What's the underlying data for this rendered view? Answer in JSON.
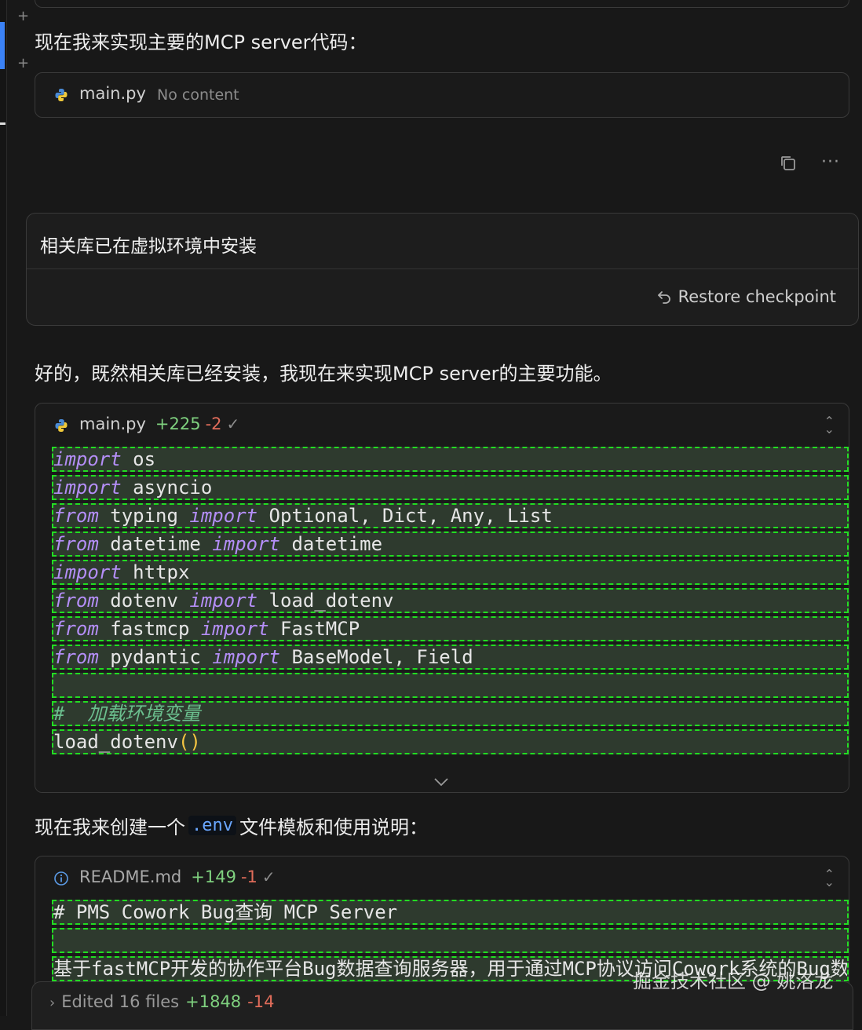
{
  "intro_text": "现在我来实现主要的MCP server代码：",
  "card1": {
    "filename": "main.py",
    "status": "No content"
  },
  "actions": {
    "copy_icon": "copy-icon",
    "more_icon": "ellipsis-icon",
    "more_label": "···"
  },
  "user_message": {
    "text": "相关库已在虚拟环境中安装",
    "restore_label": "Restore checkpoint"
  },
  "reply_text": "好的，既然相关库已经安装，我现在来实现MCP server的主要功能。",
  "main_diff": {
    "filename": "main.py",
    "added": "+225",
    "removed": "-2",
    "check": "✓",
    "lines": [
      [
        {
          "t": "import",
          "k": "kw"
        },
        {
          "t": " os",
          "k": ""
        }
      ],
      [
        {
          "t": "import",
          "k": "kw"
        },
        {
          "t": " asyncio",
          "k": ""
        }
      ],
      [
        {
          "t": "from",
          "k": "kw"
        },
        {
          "t": " typing ",
          "k": ""
        },
        {
          "t": "import",
          "k": "kw"
        },
        {
          "t": " Optional, Dict, Any, List",
          "k": ""
        }
      ],
      [
        {
          "t": "from",
          "k": "kw"
        },
        {
          "t": " datetime ",
          "k": ""
        },
        {
          "t": "import",
          "k": "kw"
        },
        {
          "t": " datetime",
          "k": ""
        }
      ],
      [
        {
          "t": "import",
          "k": "kw"
        },
        {
          "t": " httpx",
          "k": ""
        }
      ],
      [
        {
          "t": "from",
          "k": "kw"
        },
        {
          "t": " dotenv ",
          "k": ""
        },
        {
          "t": "import",
          "k": "kw"
        },
        {
          "t": " load_dotenv",
          "k": ""
        }
      ],
      [
        {
          "t": "from",
          "k": "kw"
        },
        {
          "t": " fastmcp ",
          "k": ""
        },
        {
          "t": "import",
          "k": "kw"
        },
        {
          "t": " FastMCP",
          "k": ""
        }
      ],
      [
        {
          "t": "from",
          "k": "kw"
        },
        {
          "t": " pydantic ",
          "k": ""
        },
        {
          "t": "import",
          "k": "kw"
        },
        {
          "t": " BaseModel, Field",
          "k": ""
        }
      ],
      [
        {
          "t": "",
          "k": ""
        }
      ],
      [
        {
          "t": "#  加载环境变量",
          "k": "cm"
        }
      ],
      [
        {
          "t": "load_dotenv",
          "k": ""
        },
        {
          "t": "()",
          "k": "paren"
        }
      ]
    ]
  },
  "env_text": {
    "before": "现在我来创建一个",
    "code": ".env",
    "after": "文件模板和使用说明："
  },
  "readme_diff": {
    "filename": "README.md",
    "added": "+149",
    "removed": "-1",
    "check": "✓",
    "lines": [
      [
        {
          "t": "# PMS Cowork Bug查询 MCP Server",
          "k": ""
        }
      ],
      [
        {
          "t": "",
          "k": ""
        }
      ],
      [
        {
          "t": "基于fastMCP开发的协作平台Bug数据查询服务器，用于通过MCP协议访问Cowork系统的Bug数",
          "k": ""
        }
      ]
    ]
  },
  "bottom_bar": {
    "label": "Edited 16 files",
    "added": "+1848",
    "removed": "-14"
  },
  "watermark": "掘金技术社区 @ 姚洛龙"
}
